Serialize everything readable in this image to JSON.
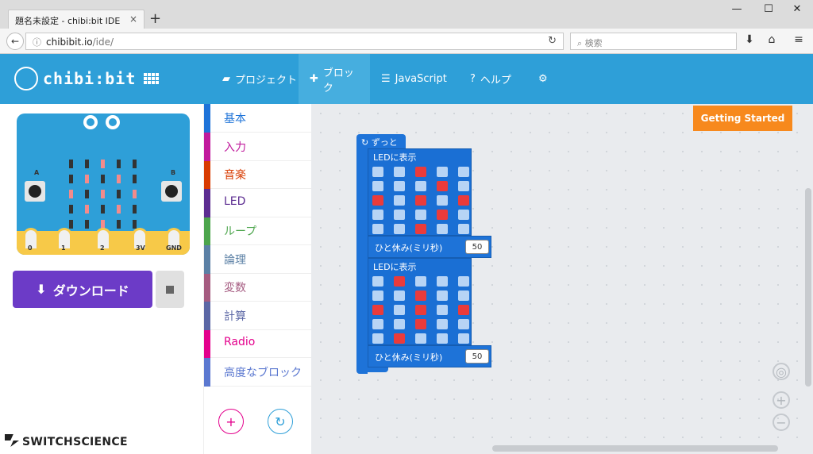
{
  "browser": {
    "tab_title": "題名未設定 - chibi:bit IDE",
    "tab_close": "×",
    "new_tab": "+",
    "url_host": "chibibit.io",
    "url_path": "/ide/",
    "search_placeholder": "検索",
    "window_controls": [
      "—",
      "☐",
      "✕"
    ]
  },
  "app": {
    "logo_text": "chibi:bit",
    "menu": [
      {
        "label": "プロジェクト",
        "icon": "folder-icon"
      },
      {
        "label": "ブロック",
        "icon": "puzzle-icon",
        "active": true
      },
      {
        "label": "JavaScript",
        "icon": "code-icon"
      },
      {
        "label": "ヘルプ",
        "icon": "question-icon"
      },
      {
        "label": "",
        "icon": "gear-icon"
      }
    ],
    "accent_color": "#2e9fd8"
  },
  "simulator": {
    "button_a": "A",
    "button_b": "B",
    "pins": [
      "0",
      "1",
      "2",
      "3V",
      "GND"
    ],
    "leds": [
      [
        0,
        0,
        1,
        0,
        0
      ],
      [
        0,
        1,
        0,
        1,
        0
      ],
      [
        1,
        0,
        1,
        0,
        1
      ],
      [
        0,
        1,
        0,
        1,
        0
      ],
      [
        0,
        0,
        1,
        0,
        0
      ]
    ],
    "download_label": "ダウンロード",
    "brand": "SWITCHSCIENCE"
  },
  "toolbox": {
    "categories": [
      {
        "label": "基本",
        "color": "#1e73d8"
      },
      {
        "label": "入力",
        "color": "#c01a9c"
      },
      {
        "label": "音楽",
        "color": "#d83b01"
      },
      {
        "label": "LED",
        "color": "#5c2d91"
      },
      {
        "label": "ループ",
        "color": "#4ca54c"
      },
      {
        "label": "論理",
        "color": "#5b80a5"
      },
      {
        "label": "変数",
        "color": "#a55b80"
      },
      {
        "label": "計算",
        "color": "#5b67a5"
      },
      {
        "label": "Radio",
        "color": "#e3008c"
      },
      {
        "label": "高度なブロック",
        "color": "#5b78d0"
      }
    ],
    "add_icon": "+",
    "undo_icon": "↻"
  },
  "workspace": {
    "getting_started": "Getting Started",
    "forever_label": "ずっと",
    "show_leds_label": "LEDに表示",
    "pause_label": "ひと休み(ミリ秒)",
    "blocks": [
      {
        "leds": [
          [
            0,
            0,
            1,
            0,
            0
          ],
          [
            0,
            0,
            0,
            1,
            0
          ],
          [
            1,
            0,
            1,
            0,
            1
          ],
          [
            0,
            0,
            0,
            1,
            0
          ],
          [
            0,
            0,
            1,
            0,
            0
          ]
        ],
        "pause": "50"
      },
      {
        "leds": [
          [
            0,
            1,
            0,
            0,
            0
          ],
          [
            0,
            0,
            1,
            0,
            0
          ],
          [
            1,
            0,
            1,
            0,
            1
          ],
          [
            0,
            0,
            1,
            0,
            0
          ],
          [
            0,
            1,
            0,
            0,
            0
          ]
        ],
        "pause": "50"
      }
    ]
  }
}
